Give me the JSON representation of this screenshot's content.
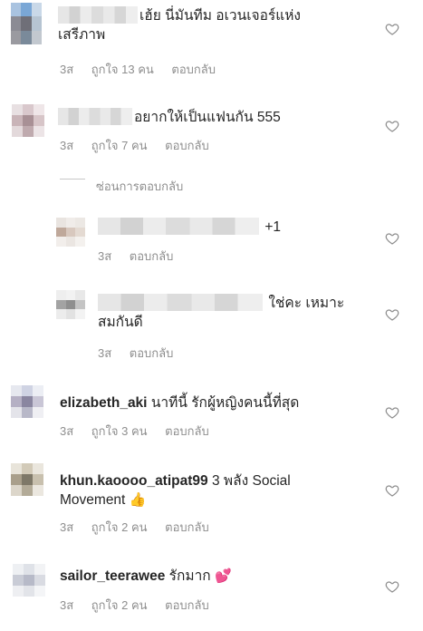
{
  "comments": [
    {
      "text": "เฮ้ย นี่มันทีม อเวนเจอร์แห่ง",
      "text2": "เสรีภาพ",
      "time": "3ส",
      "likes": "ถูกใจ 13 คน",
      "reply": "ตอบกลับ"
    },
    {
      "text": "อยากให้เป็นแฟนกัน 555",
      "time": "3ส",
      "likes": "ถูกใจ 7 คน",
      "reply": "ตอบกลับ"
    },
    {
      "text": "+1",
      "time": "3ส",
      "reply": "ตอบกลับ"
    },
    {
      "text": "ใช่คะ เหมาะ",
      "text2": "สมกันดี",
      "time": "3ส",
      "reply": "ตอบกลับ"
    },
    {
      "user": "elizabeth_aki",
      "text": "นาทีนี้ รักผู้หญิงคนนี้ที่สุด",
      "time": "3ส",
      "likes": "ถูกใจ 3 คน",
      "reply": "ตอบกลับ"
    },
    {
      "user": "khun.kaoooo_atipat99",
      "text": "3 พลัง Social",
      "text2": "Movement",
      "emoji": "👍",
      "time": "3ส",
      "likes": "ถูกใจ 2 คน",
      "reply": "ตอบกลับ"
    },
    {
      "user": "sailor_teerawee",
      "text": "รักมาก",
      "emoji": "💕",
      "time": "3ส",
      "likes": "ถูกใจ 2 คน",
      "reply": "ตอบกลับ"
    }
  ],
  "hide_replies": "ซ่อนการตอบกลับ"
}
